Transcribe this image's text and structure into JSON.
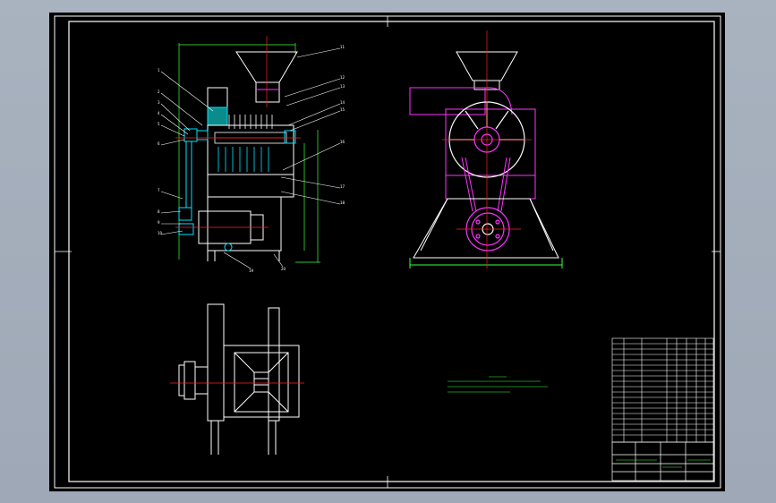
{
  "drawing": {
    "title_block_caption": "",
    "technical_notes": [],
    "part_callouts": [
      "1",
      "2",
      "3",
      "4",
      "5",
      "6",
      "7",
      "8",
      "9",
      "10",
      "11",
      "12",
      "13",
      "14",
      "15",
      "16",
      "17",
      "18",
      "19",
      "20",
      "21",
      "22",
      "23",
      "24",
      "25"
    ],
    "colors": {
      "sheet": "#000000",
      "frame": "#ffffff",
      "outline": "#ffffff",
      "hopper": "#ffffff",
      "centerline": "#ff2020",
      "blue_section": "#00e5ff",
      "magenta": "#ff33ff",
      "green_text": "#3dff3d",
      "yellow_dim": "#ffff33",
      "desktop": "#a6afbd"
    }
  }
}
